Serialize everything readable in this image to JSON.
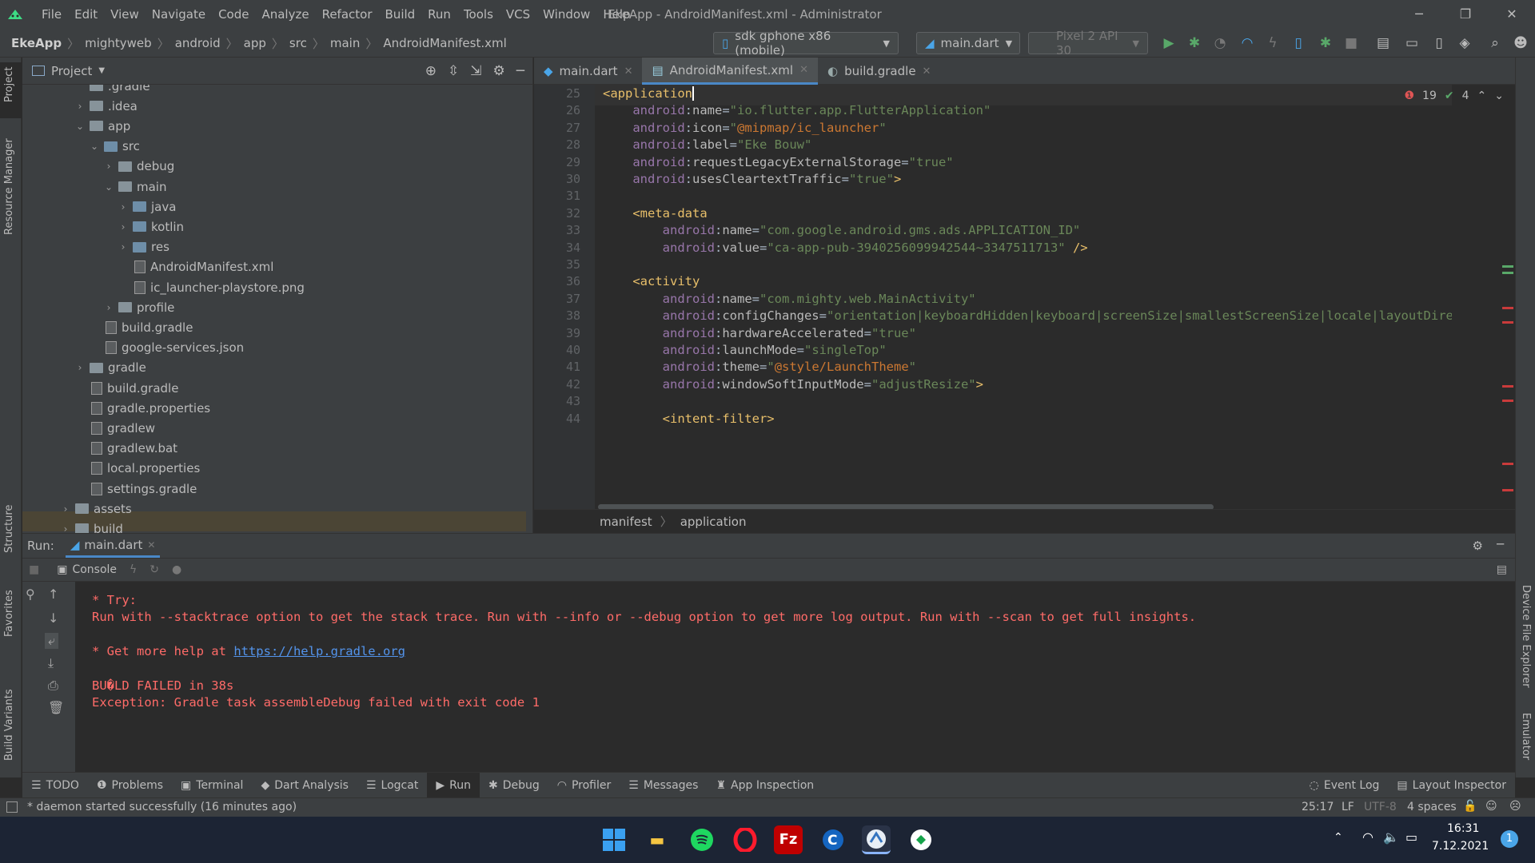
{
  "window": {
    "title": "EkeApp - AndroidManifest.xml - Administrator",
    "menu": [
      "File",
      "Edit",
      "View",
      "Navigate",
      "Code",
      "Analyze",
      "Refactor",
      "Build",
      "Run",
      "Tools",
      "VCS",
      "Window",
      "Help"
    ]
  },
  "breadcrumb": [
    "EkeApp",
    "mightyweb",
    "android",
    "app",
    "src",
    "main",
    "AndroidManifest.xml"
  ],
  "toolbar": {
    "device": "sdk gphone x86 (mobile)",
    "run_config": "main.dart",
    "avd": "Pixel 2 API 30"
  },
  "project": {
    "title": "Project",
    "tree": [
      {
        "label": ".gradle",
        "depth": 4,
        "type": "folder",
        "arrow": ""
      },
      {
        "label": ".idea",
        "depth": 4,
        "type": "folder",
        "arrow": "›"
      },
      {
        "label": "app",
        "depth": 4,
        "type": "folder",
        "arrow": "⌄"
      },
      {
        "label": "src",
        "depth": 5,
        "type": "folder",
        "arrow": "⌄"
      },
      {
        "label": "debug",
        "depth": 6,
        "type": "folder",
        "arrow": "›"
      },
      {
        "label": "main",
        "depth": 6,
        "type": "folder",
        "arrow": "⌄"
      },
      {
        "label": "java",
        "depth": 7,
        "type": "folder",
        "arrow": "›"
      },
      {
        "label": "kotlin",
        "depth": 7,
        "type": "folder",
        "arrow": "›"
      },
      {
        "label": "res",
        "depth": 7,
        "type": "folder",
        "arrow": "›"
      },
      {
        "label": "AndroidManifest.xml",
        "depth": 7,
        "type": "file",
        "arrow": ""
      },
      {
        "label": "ic_launcher-playstore.png",
        "depth": 7,
        "type": "file",
        "arrow": ""
      },
      {
        "label": "profile",
        "depth": 6,
        "type": "folder",
        "arrow": "›"
      },
      {
        "label": "build.gradle",
        "depth": 5,
        "type": "file",
        "arrow": ""
      },
      {
        "label": "google-services.json",
        "depth": 5,
        "type": "file",
        "arrow": ""
      },
      {
        "label": "gradle",
        "depth": 4,
        "type": "folder",
        "arrow": "›"
      },
      {
        "label": "build.gradle",
        "depth": 4,
        "type": "file",
        "arrow": ""
      },
      {
        "label": "gradle.properties",
        "depth": 4,
        "type": "file",
        "arrow": ""
      },
      {
        "label": "gradlew",
        "depth": 4,
        "type": "file",
        "arrow": ""
      },
      {
        "label": "gradlew.bat",
        "depth": 4,
        "type": "file",
        "arrow": ""
      },
      {
        "label": "local.properties",
        "depth": 4,
        "type": "file",
        "arrow": ""
      },
      {
        "label": "settings.gradle",
        "depth": 4,
        "type": "file",
        "arrow": ""
      },
      {
        "label": "assets",
        "depth": 3,
        "type": "folder",
        "arrow": "›"
      },
      {
        "label": "build",
        "depth": 3,
        "type": "folder",
        "arrow": "›"
      }
    ]
  },
  "editor": {
    "tabs": [
      "main.dart",
      "AndroidManifest.xml",
      "build.gradle"
    ],
    "errors": "19",
    "warnings": "4",
    "lines": [
      {
        "n": "25",
        "html": "<span class='tg'>&lt;application</span>"
      },
      {
        "n": "26",
        "html": "    <span class='an'>android</span>:<span class='at'>name</span>=<span class='av'>\"io.flutter.app.FlutterApplication\"</span>"
      },
      {
        "n": "27",
        "html": "    <span class='an'>android</span>:<span class='at'>icon</span>=<span class='av'>\"</span><span class='rv'>@mipmap/ic_launcher</span><span class='av'>\"</span>"
      },
      {
        "n": "28",
        "html": "    <span class='an'>android</span>:<span class='at'>label</span>=<span class='av'>\"Eke Bouw\"</span>"
      },
      {
        "n": "29",
        "html": "    <span class='an'>android</span>:<span class='at'>requestLegacyExternalStorage</span>=<span class='av'>\"true\"</span>"
      },
      {
        "n": "30",
        "html": "    <span class='an'>android</span>:<span class='at'>usesCleartextTraffic</span>=<span class='av'>\"true\"</span><span class='tg'>&gt;</span>"
      },
      {
        "n": "31",
        "html": ""
      },
      {
        "n": "32",
        "html": "    <span class='tg'>&lt;meta-data</span>"
      },
      {
        "n": "33",
        "html": "        <span class='an'>android</span>:<span class='at'>name</span>=<span class='av'>\"com.google.android.gms.ads.APPLICATION_ID\"</span>"
      },
      {
        "n": "34",
        "html": "        <span class='an'>android</span>:<span class='at'>value</span>=<span class='av'>\"ca-app-pub-3940256099942544~3347511713\"</span> <span class='tg'>/&gt;</span>"
      },
      {
        "n": "35",
        "html": ""
      },
      {
        "n": "36",
        "html": "    <span class='tg'>&lt;activity</span>"
      },
      {
        "n": "37",
        "html": "        <span class='an'>android</span>:<span class='at'>name</span>=<span class='av'>\"com.mighty.web.MainActivity\"</span>"
      },
      {
        "n": "38",
        "html": "        <span class='an'>android</span>:<span class='at'>configChanges</span>=<span class='av'>\"orientation|keyboardHidden|keyboard|screenSize|smallestScreenSize|locale|layoutDirection\"</span>"
      },
      {
        "n": "39",
        "html": "        <span class='an'>android</span>:<span class='at'>hardwareAccelerated</span>=<span class='av'>\"true\"</span>"
      },
      {
        "n": "40",
        "html": "        <span class='an'>android</span>:<span class='at'>launchMode</span>=<span class='av'>\"singleTop\"</span>"
      },
      {
        "n": "41",
        "html": "        <span class='an'>android</span>:<span class='at'>theme</span>=<span class='av'>\"</span><span class='rv'>@style/LaunchTheme</span><span class='av'>\"</span>"
      },
      {
        "n": "42",
        "html": "        <span class='an'>android</span>:<span class='at'>windowSoftInputMode</span>=<span class='av'>\"adjustResize\"</span><span class='tg'>&gt;</span>"
      },
      {
        "n": "43",
        "html": ""
      },
      {
        "n": "44",
        "html": "        <span class='tg'>&lt;intent-filter&gt;</span>"
      }
    ],
    "crumbs": [
      "manifest",
      "application"
    ]
  },
  "run": {
    "label": "Run:",
    "config": "main.dart",
    "console_tab": "Console",
    "output": [
      {
        "text": "* Try:",
        "link": ""
      },
      {
        "text": "Run with --stacktrace option to get the stack trace. Run with --info or --debug option to get more log output. Run with --scan to get full insights.",
        "link": ""
      },
      {
        "text": "",
        "link": ""
      },
      {
        "text": "* Get more help at ",
        "link": "https://help.gradle.org"
      },
      {
        "text": "",
        "link": ""
      },
      {
        "text": "BU�LD FAILED in 38s",
        "link": ""
      },
      {
        "text": "Exception: Gradle task assembleDebug failed with exit code 1",
        "link": ""
      }
    ]
  },
  "bottom_tools": [
    "TODO",
    "Problems",
    "Terminal",
    "Dart Analysis",
    "Logcat",
    "Run",
    "Debug",
    "Profiler",
    "Messages",
    "App Inspection"
  ],
  "bottom_tools_right": [
    "Event Log",
    "Layout Inspector"
  ],
  "side_tools_left": [
    "Project",
    "Resource Manager",
    "Structure",
    "Favorites",
    "Build Variants"
  ],
  "side_tools_right": [
    "Device File Explorer",
    "Emulator"
  ],
  "status": {
    "message": "* daemon started successfully (16 minutes ago)",
    "position": "25:17",
    "line_sep": "LF",
    "encoding": "UTF-8",
    "indent": "4 spaces"
  },
  "taskbar": {
    "time": "16:31",
    "date": "7.12.2021",
    "notifications": "1"
  }
}
